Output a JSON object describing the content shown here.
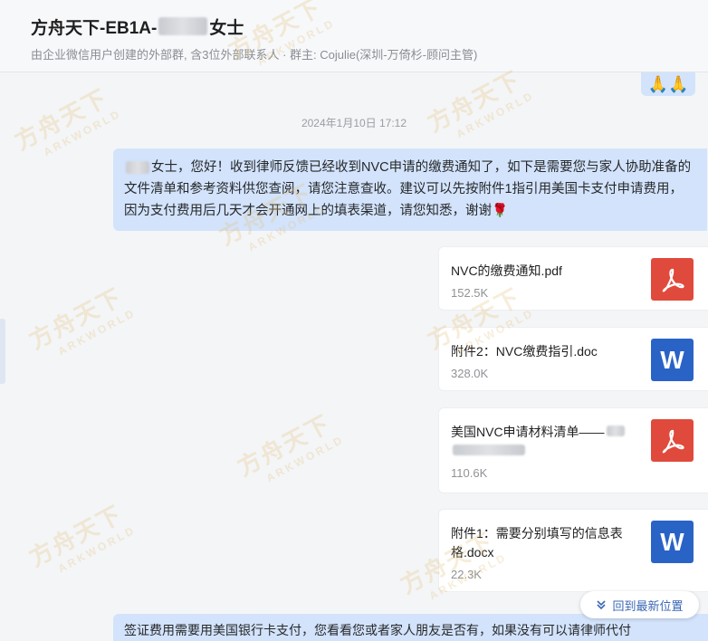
{
  "header": {
    "title_prefix": "方舟天下-EB1A-",
    "title_suffix": "女士",
    "subtitle": "由企业微信用户创建的外部群, 含3位外部联系人 · 群主: Cojulie(深圳-万倚杉-顾问主管)"
  },
  "top_bubble": {
    "emoji": "🙏🙏"
  },
  "timestamp": "2024年1月10日 17:12",
  "message": {
    "text": "女士，您好！收到律师反馈已经收到NVC申请的缴费通知了，如下是需要您与家人协助准备的文件清单和参考资料供您查阅，请您注意查收。建议可以先按附件1指引用美国卡支付申请费用，因为支付费用后几天才会开通网上的填表渠道，请您知悉，谢谢🌹"
  },
  "files": [
    {
      "name": "NVC的缴费通知.pdf",
      "size": "152.5K",
      "type": "pdf"
    },
    {
      "name": "附件2：NVC缴费指引.doc",
      "size": "328.0K",
      "type": "word"
    },
    {
      "name": "美国NVC申请材料清单——",
      "size": "110.6K",
      "type": "pdf"
    },
    {
      "name": "附件1：需要分别填写的信息表格.docx",
      "size": "22.3K",
      "type": "word"
    }
  ],
  "bottom_message": {
    "text": "签证费用需要用美国银行卡支付，您看看您或者家人朋友是否有，如果没有可以请律师代付"
  },
  "jump_button": {
    "label": "回到最新位置"
  },
  "watermark": {
    "cn": "方舟天下",
    "en": "ARKWORLD"
  },
  "colors": {
    "bubble": "#d3e3fb",
    "pdf": "#e04a3c",
    "word": "#2a63c6",
    "link": "#3a67b5"
  }
}
